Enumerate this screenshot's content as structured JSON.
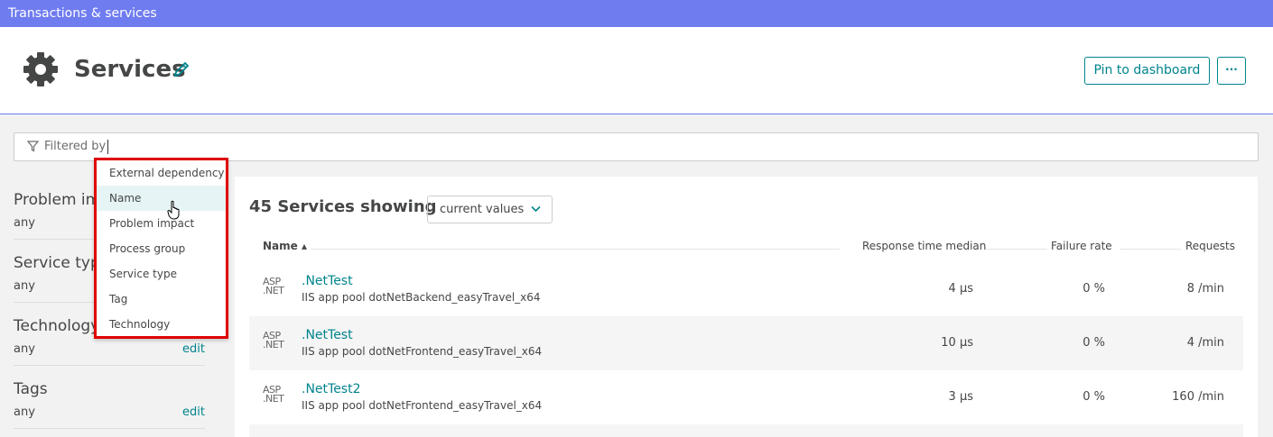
{
  "topbar": {
    "title": "Transactions & services"
  },
  "header": {
    "title": "Services",
    "pin_label": "Pin to dashboard",
    "more_label": "···"
  },
  "filter": {
    "label": "Filtered by"
  },
  "dropdown": {
    "items": [
      "External dependency",
      "Name",
      "Problem impact",
      "Process group",
      "Service type",
      "Tag",
      "Technology"
    ],
    "hovered": "Name"
  },
  "sidebar": {
    "facets": [
      {
        "title": "Problem impact",
        "value": "any",
        "edit": ""
      },
      {
        "title": "Service type",
        "value": "any",
        "edit": ""
      },
      {
        "title": "Technology",
        "value": "any",
        "edit": "edit"
      },
      {
        "title": "Tags",
        "value": "any",
        "edit": "edit"
      }
    ]
  },
  "main": {
    "count_title": "45 Services showing",
    "select_value": "current values",
    "columns": {
      "name": "Name ▴",
      "response_time": "Response time median",
      "failure_rate": "Failure rate",
      "requests": "Requests"
    },
    "rows": [
      {
        "tech_line1": "ASP",
        "tech_line2": ".NET",
        "name": ".NetTest",
        "sub": "IIS app pool dotNetBackend_easyTravel_x64",
        "response_time": "4 μs",
        "failure_rate": "0 %",
        "requests": "8 /min"
      },
      {
        "tech_line1": "ASP",
        "tech_line2": ".NET",
        "name": ".NetTest",
        "sub": "IIS app pool dotNetFrontend_easyTravel_x64",
        "response_time": "10 μs",
        "failure_rate": "0 %",
        "requests": "4 /min"
      },
      {
        "tech_line1": "ASP",
        "tech_line2": ".NET",
        "name": ".NetTest2",
        "sub": "IIS app pool dotNetFrontend_easyTravel_x64",
        "response_time": "3 μs",
        "failure_rate": "0 %",
        "requests": "160 /min"
      }
    ]
  },
  "colors": {
    "topbar": "#6f7cf0",
    "accent": "#00848d",
    "highlight": "#e00000"
  },
  "icons": [
    "gear-icon",
    "pencil-icon",
    "filter-icon",
    "chevron-down-icon",
    "hand-cursor-icon"
  ]
}
